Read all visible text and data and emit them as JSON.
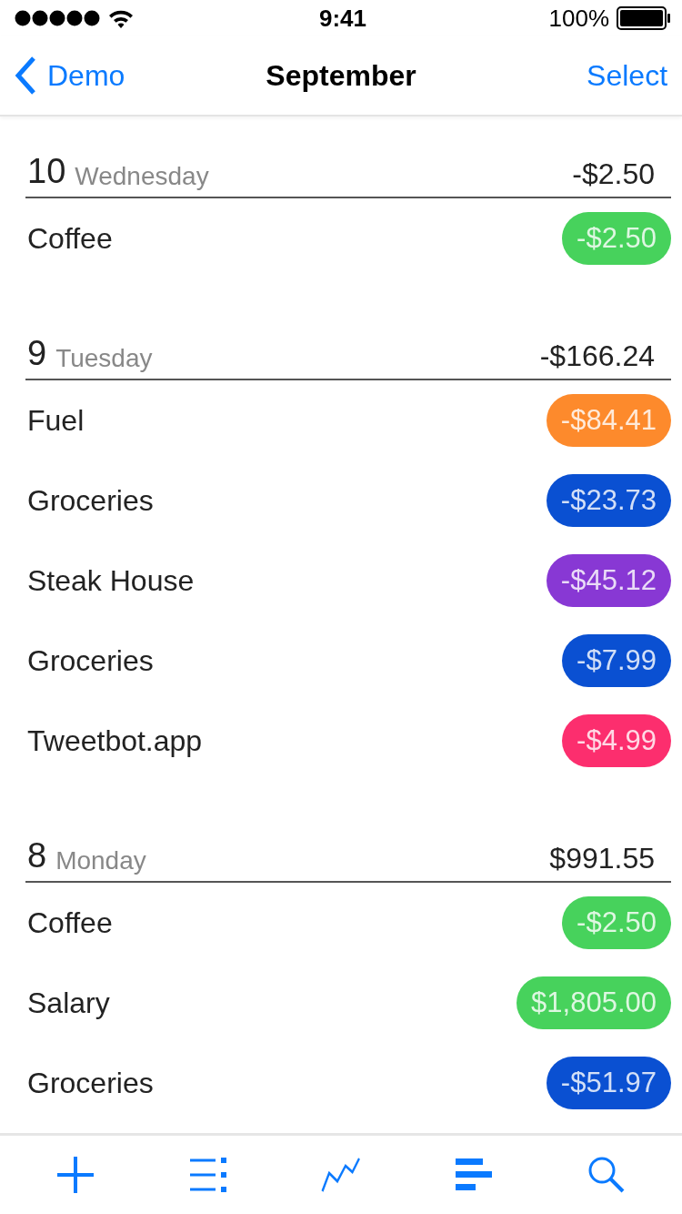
{
  "status_bar": {
    "time": "9:41",
    "battery": "100%"
  },
  "nav": {
    "back": "Demo",
    "title": "September",
    "action": "Select"
  },
  "days": [
    {
      "day": "10",
      "weekday": "Wednesday",
      "total": "-$2.50",
      "transactions": [
        {
          "name": "Coffee",
          "amount": "-$2.50",
          "color": "#47d25c"
        }
      ]
    },
    {
      "day": "9",
      "weekday": "Tuesday",
      "total": "-$166.24",
      "transactions": [
        {
          "name": "Fuel",
          "amount": "-$84.41",
          "color": "#fd8a2c"
        },
        {
          "name": "Groceries",
          "amount": "-$23.73",
          "color": "#0a50d2"
        },
        {
          "name": "Steak House",
          "amount": "-$45.12",
          "color": "#8838d4"
        },
        {
          "name": "Groceries",
          "amount": "-$7.99",
          "color": "#0a50d2"
        },
        {
          "name": "Tweetbot.app",
          "amount": "-$4.99",
          "color": "#fc2e6e"
        }
      ]
    },
    {
      "day": "8",
      "weekday": "Monday",
      "total": "$991.55",
      "transactions": [
        {
          "name": "Coffee",
          "amount": "-$2.50",
          "color": "#47d25c"
        },
        {
          "name": "Salary",
          "amount": "$1,805.00",
          "color": "#47d25c"
        },
        {
          "name": "Groceries",
          "amount": "-$51.97",
          "color": "#0a50d2"
        }
      ]
    }
  ],
  "tabs": [
    {
      "kind": "add"
    },
    {
      "kind": "list"
    },
    {
      "kind": "trend"
    },
    {
      "kind": "bars"
    },
    {
      "kind": "search"
    }
  ]
}
